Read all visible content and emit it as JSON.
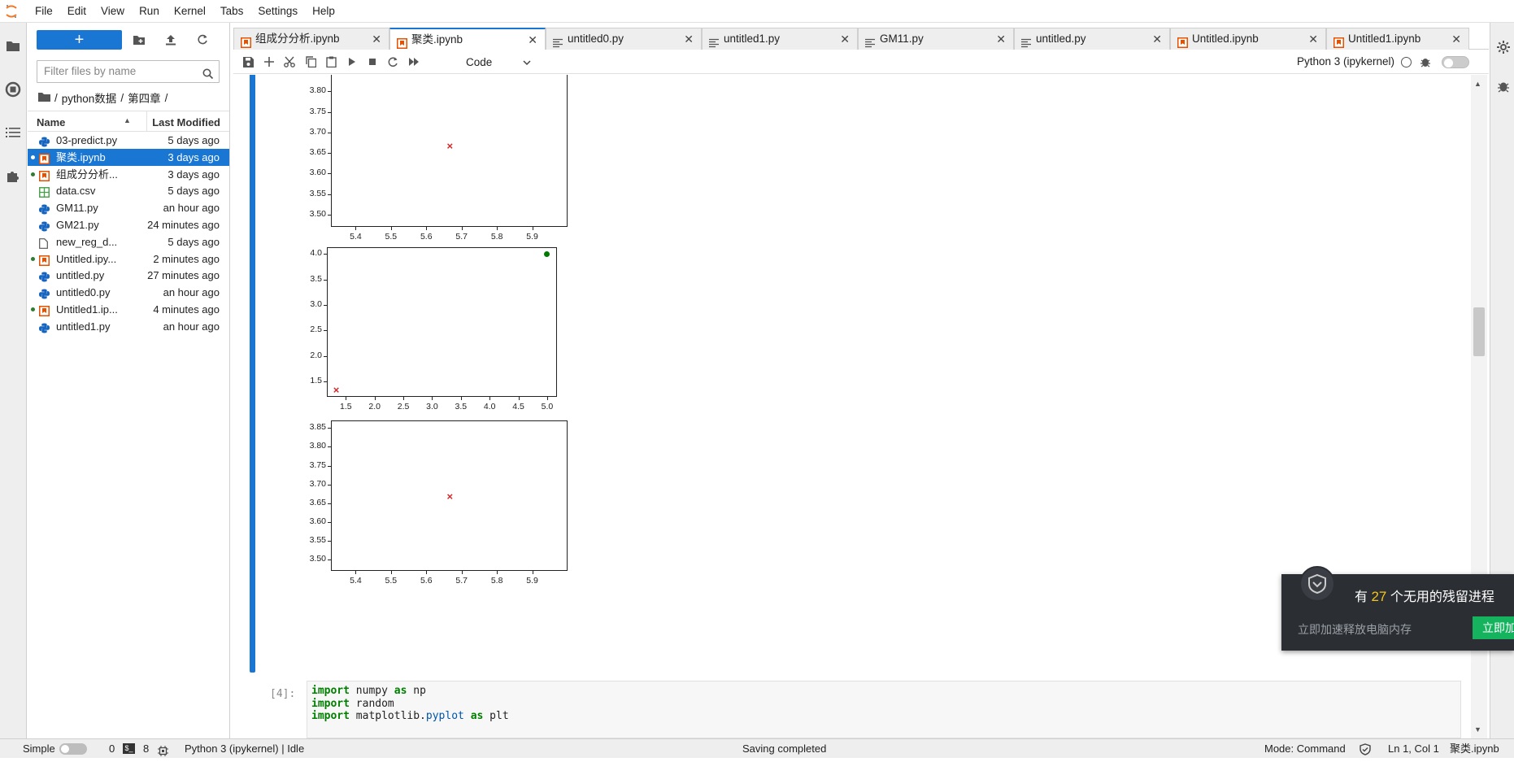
{
  "menubar": {
    "items": [
      "File",
      "Edit",
      "View",
      "Run",
      "Kernel",
      "Tabs",
      "Settings",
      "Help"
    ]
  },
  "filebrowser": {
    "new_label": "+",
    "filter_placeholder": "Filter files by name",
    "breadcrumb": [
      "/",
      "python数据",
      "/",
      "第四章",
      "/"
    ],
    "header": {
      "name": "Name",
      "modified": "Last Modified"
    },
    "files": [
      {
        "name": "03-predict.py",
        "modified": "5 days ago",
        "type": "py",
        "running": false,
        "selected": false
      },
      {
        "name": "聚类.ipynb",
        "modified": "3 days ago",
        "type": "nb",
        "running": true,
        "selected": true
      },
      {
        "name": "组成分分析...",
        "modified": "3 days ago",
        "type": "nb",
        "running": true,
        "selected": false
      },
      {
        "name": "data.csv",
        "modified": "5 days ago",
        "type": "csv",
        "running": false,
        "selected": false
      },
      {
        "name": "GM11.py",
        "modified": "an hour ago",
        "type": "py",
        "running": false,
        "selected": false
      },
      {
        "name": "GM21.py",
        "modified": "24 minutes ago",
        "type": "py",
        "running": false,
        "selected": false
      },
      {
        "name": "new_reg_d...",
        "modified": "5 days ago",
        "type": "file",
        "running": false,
        "selected": false
      },
      {
        "name": "Untitled.ipy...",
        "modified": "2 minutes ago",
        "type": "nb",
        "running": true,
        "selected": false
      },
      {
        "name": "untitled.py",
        "modified": "27 minutes ago",
        "type": "py",
        "running": false,
        "selected": false
      },
      {
        "name": "untitled0.py",
        "modified": "an hour ago",
        "type": "py",
        "running": false,
        "selected": false
      },
      {
        "name": "Untitled1.ip...",
        "modified": "4 minutes ago",
        "type": "nb",
        "running": true,
        "selected": false
      },
      {
        "name": "untitled1.py",
        "modified": "an hour ago",
        "type": "py",
        "running": false,
        "selected": false
      }
    ]
  },
  "tabs": [
    {
      "label": "组成分分析.ipynb",
      "type": "nb",
      "active": false
    },
    {
      "label": "聚类.ipynb",
      "type": "nb",
      "active": true
    },
    {
      "label": "untitled0.py",
      "type": "text",
      "active": false
    },
    {
      "label": "untitled1.py",
      "type": "text",
      "active": false
    },
    {
      "label": "GM11.py",
      "type": "text",
      "active": false
    },
    {
      "label": "untitled.py",
      "type": "text",
      "active": false
    },
    {
      "label": "Untitled.ipynb",
      "type": "nb",
      "active": false
    },
    {
      "label": "Untitled1.ipynb",
      "type": "nb",
      "active": false
    }
  ],
  "toolbar": {
    "cell_type": "Code",
    "kernel": "Python 3 (ipykernel)"
  },
  "plots": [
    {
      "yticks": [
        "3.80",
        "3.75",
        "3.70",
        "3.65",
        "3.60",
        "3.55",
        "3.50"
      ],
      "xticks": [
        "5.4",
        "5.5",
        "5.6",
        "5.7",
        "5.8",
        "5.9"
      ]
    },
    {
      "yticks": [
        "4.0",
        "3.5",
        "3.0",
        "2.5",
        "2.0",
        "1.5"
      ],
      "xticks": [
        "1.5",
        "2.0",
        "2.5",
        "3.0",
        "3.5",
        "4.0",
        "4.5",
        "5.0"
      ]
    },
    {
      "yticks": [
        "3.85",
        "3.80",
        "3.75",
        "3.70",
        "3.65",
        "3.60",
        "3.55",
        "3.50"
      ],
      "xticks": [
        "5.4",
        "5.5",
        "5.6",
        "5.7",
        "5.8",
        "5.9"
      ]
    }
  ],
  "chart_data": [
    {
      "type": "scatter",
      "x": [
        5.6667
      ],
      "y": [
        3.6667
      ],
      "marker": "x",
      "color": "#d62728",
      "xlim": [
        5.33,
        6.0
      ],
      "ylim": [
        3.47,
        3.86
      ]
    },
    {
      "type": "scatter",
      "series": [
        {
          "x": [
            1.333
          ],
          "y": [
            1.333
          ],
          "marker": "x",
          "color": "#d62728"
        },
        {
          "x": [
            5.0
          ],
          "y": [
            4.0
          ],
          "marker": "o",
          "color": "#007a00"
        }
      ],
      "xlim": [
        1.17,
        5.17
      ],
      "ylim": [
        1.2,
        4.13
      ]
    },
    {
      "type": "scatter",
      "x": [
        5.6667
      ],
      "y": [
        3.6667
      ],
      "marker": "x",
      "color": "#d62728",
      "xlim": [
        5.33,
        6.0
      ],
      "ylim": [
        3.47,
        3.87
      ]
    }
  ],
  "code_cell": {
    "prompt": "[4]:",
    "lines": [
      [
        [
          "kw",
          "import"
        ],
        [
          "",
          " numpy "
        ],
        [
          "kw",
          "as"
        ],
        [
          "",
          " np"
        ]
      ],
      [
        [
          "kw",
          "import"
        ],
        [
          "",
          " random"
        ]
      ],
      [
        [
          "kw",
          "import"
        ],
        [
          "",
          " matplotlib."
        ],
        [
          "mod",
          "pyplot"
        ],
        [
          "",
          " "
        ],
        [
          "kw",
          "as"
        ],
        [
          "",
          " plt"
        ]
      ]
    ]
  },
  "statusbar": {
    "mode_label": "Simple",
    "terminals": "0",
    "kernels": "8",
    "kernel_status": "Python 3 (ipykernel) | Idle",
    "message": "Saving completed",
    "mode": "Mode: Command",
    "position": "Ln 1, Col 1",
    "filename": "聚类.ipynb"
  },
  "popup": {
    "title_pre": "有",
    "count": "27",
    "title_post": "个无用的残留进程",
    "subtitle": "立即加速释放电脑内存",
    "button": "立即加"
  },
  "colors": {
    "accent": "#1976d2",
    "running_dot": "#2e7d32",
    "nb_icon": "#e65100",
    "py_icon": "#1565c0",
    "csv_icon": "#43a047"
  }
}
